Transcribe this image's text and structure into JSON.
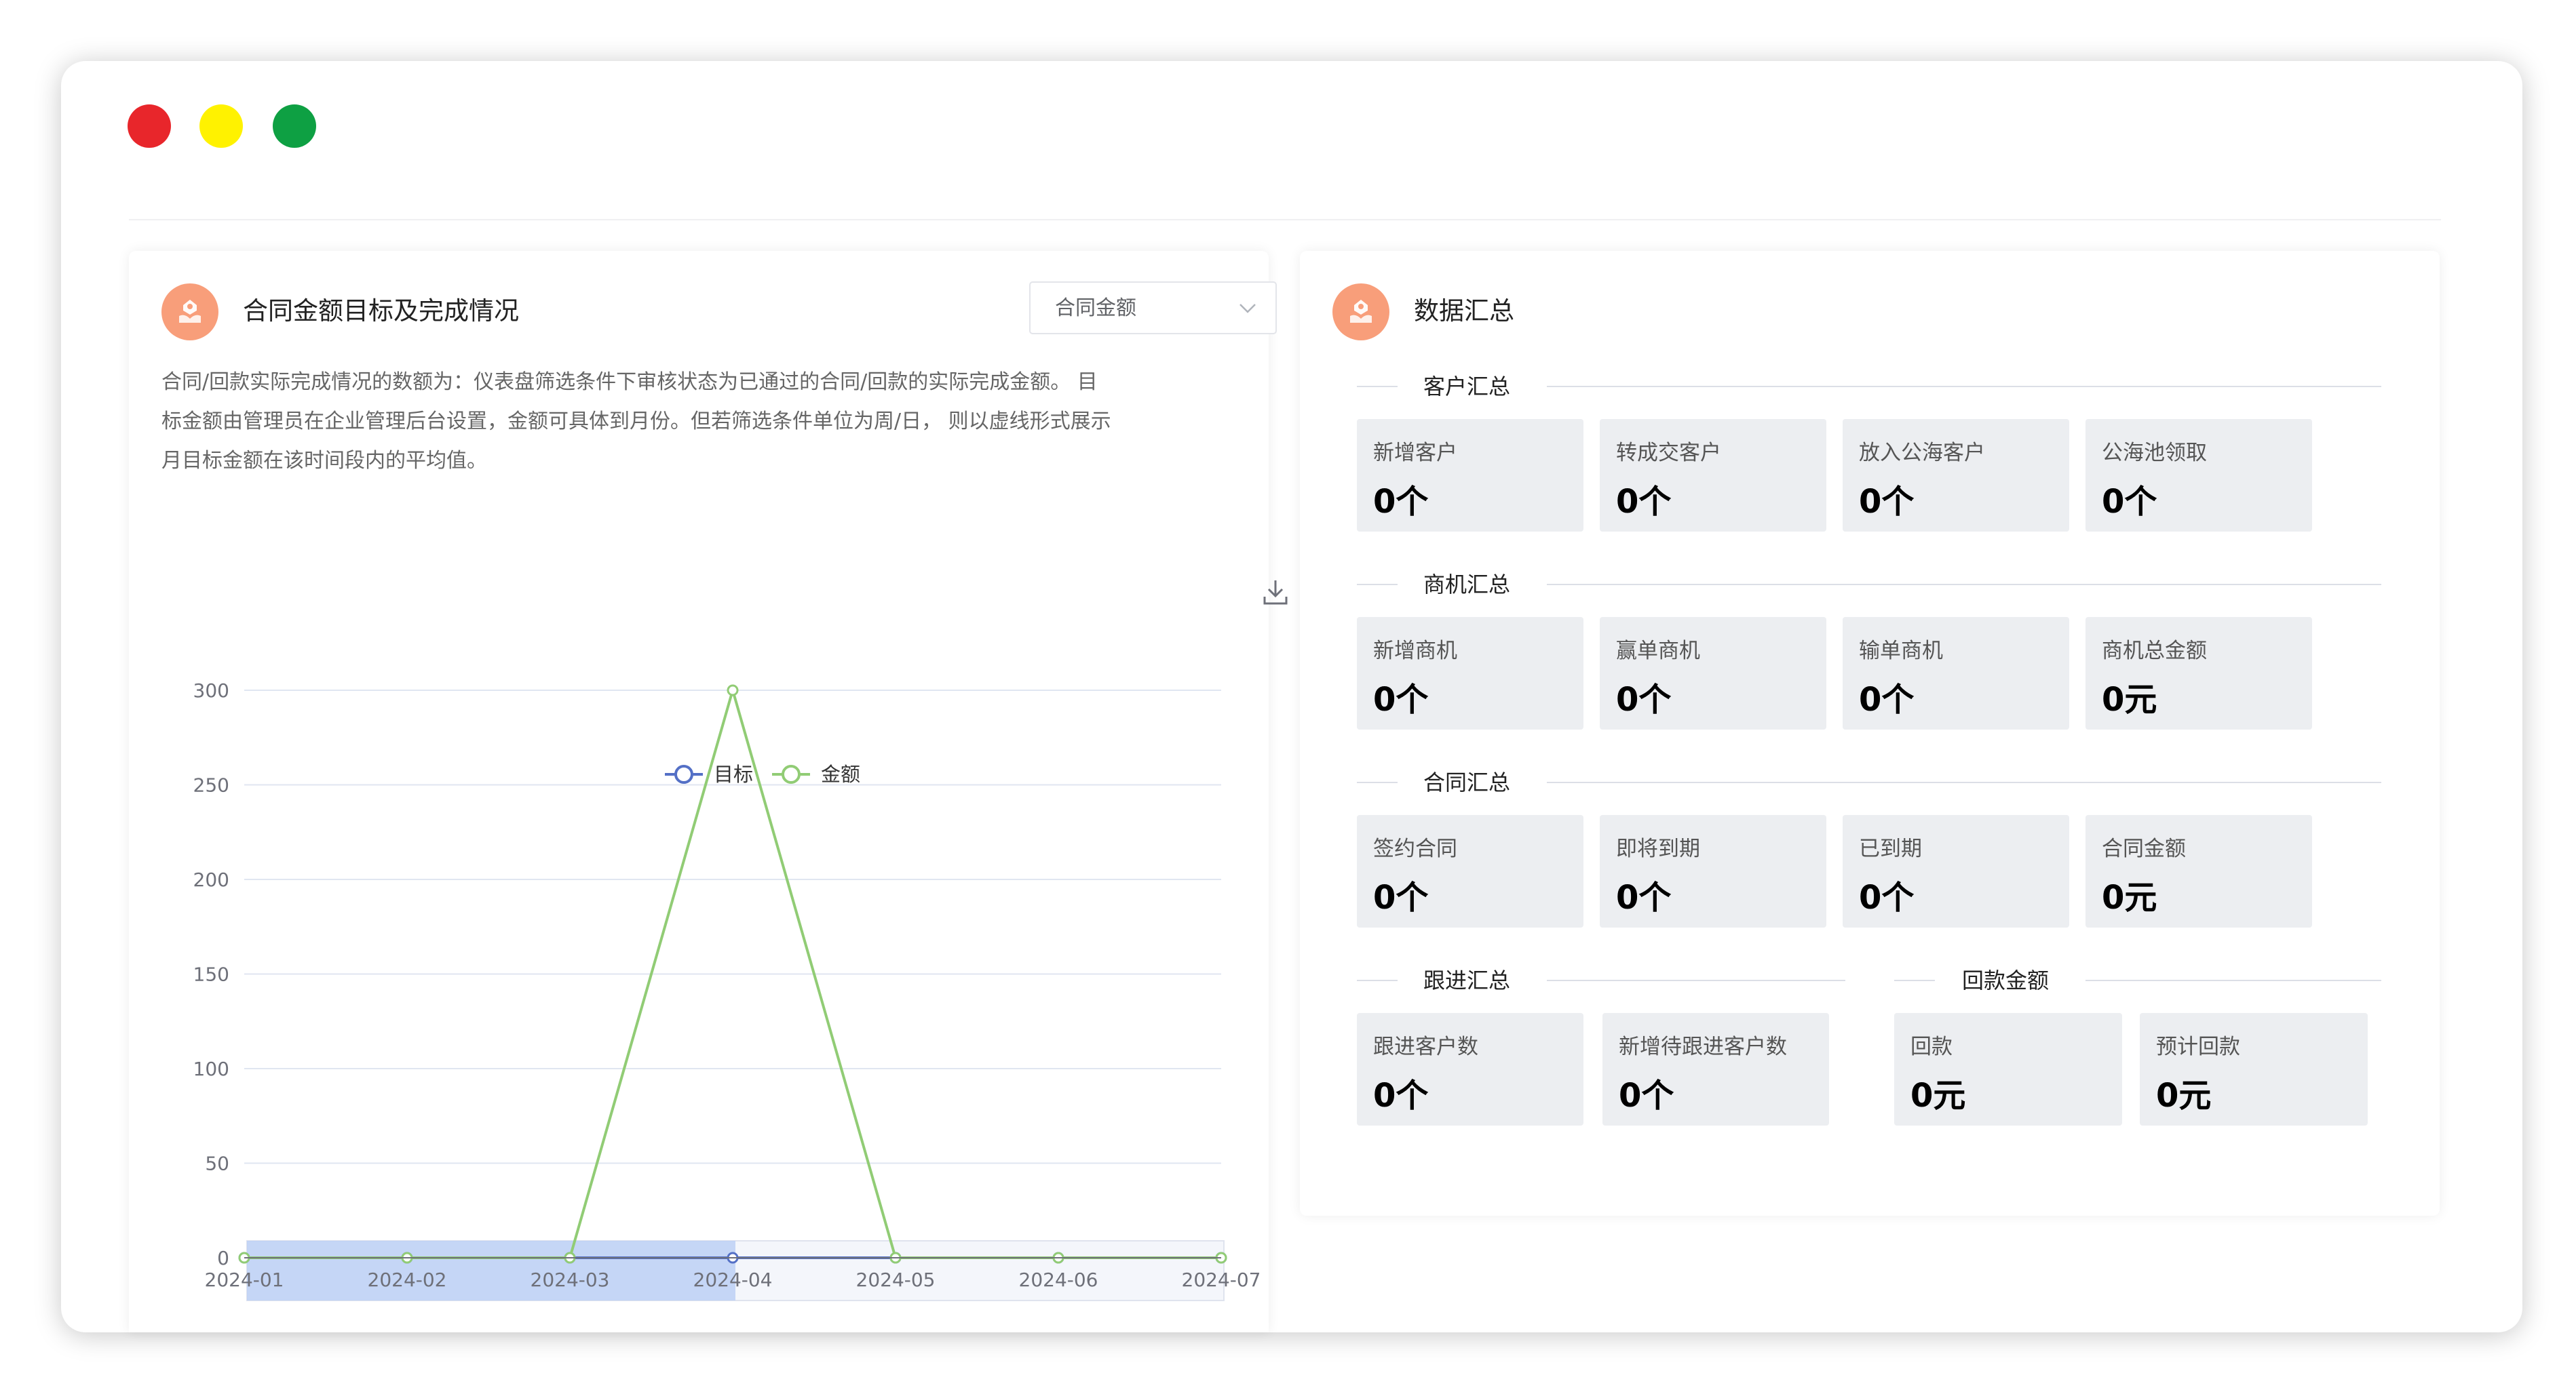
{
  "window": {
    "controls": [
      {
        "name": "close",
        "color": "#e8262b"
      },
      {
        "name": "minimize",
        "color": "#fff200"
      },
      {
        "name": "maximize",
        "color": "#0ea043"
      }
    ]
  },
  "contract_panel": {
    "title": "合同金额目标及完成情况",
    "select_value": "合同金额",
    "description_lines": [
      "合同/回款实际完成情况的数额为：仪表盘筛选条件下审核状态为已通过的合同/回款的实际完成金额。 目",
      "标金额由管理员在企业管理后台设置，金额可具体到月份。但若筛选条件单位为周/日， 则以虚线形式展示",
      "月目标金额在该时间段内的平均值。"
    ],
    "download_icon": "download-icon"
  },
  "chart_data": {
    "type": "line",
    "categories": [
      "2024-01",
      "2024-02",
      "2024-03",
      "2024-04",
      "2024-05",
      "2024-06",
      "2024-07"
    ],
    "series": [
      {
        "name": "目标",
        "color": "#5470c6",
        "values": [
          0,
          0,
          0,
          0,
          0,
          0,
          0
        ]
      },
      {
        "name": "金额",
        "color": "#91cc75",
        "values": [
          0,
          0,
          0,
          300,
          0,
          0,
          0
        ]
      }
    ],
    "yticks": [
      0,
      50,
      100,
      150,
      200,
      250,
      300
    ],
    "ylim": [
      0,
      300
    ],
    "grid": true,
    "legend": "top-center"
  },
  "summary_panel": {
    "title": "数据汇总",
    "sections": [
      {
        "title": "客户汇总",
        "cards": [
          {
            "label": "新增客户",
            "value": "0个"
          },
          {
            "label": "转成交客户",
            "value": "0个"
          },
          {
            "label": "放入公海客户",
            "value": "0个"
          },
          {
            "label": "公海池领取",
            "value": "0个"
          }
        ]
      },
      {
        "title": "商机汇总",
        "cards": [
          {
            "label": "新增商机",
            "value": "0个"
          },
          {
            "label": "赢单商机",
            "value": "0个"
          },
          {
            "label": "输单商机",
            "value": "0个"
          },
          {
            "label": "商机总金额",
            "value": "0元"
          }
        ]
      },
      {
        "title": "合同汇总",
        "cards": [
          {
            "label": "签约合同",
            "value": "0个"
          },
          {
            "label": "即将到期",
            "value": "0个"
          },
          {
            "label": "已到期",
            "value": "0个"
          },
          {
            "label": "合同金额",
            "value": "0元"
          }
        ]
      },
      {
        "title": "跟进汇总",
        "cards": [
          {
            "label": "跟进客户数",
            "value": "0个"
          },
          {
            "label": "新增待跟进客户数",
            "value": "0个"
          }
        ]
      },
      {
        "title": "回款金额",
        "cards": [
          {
            "label": "回款",
            "value": "0元"
          },
          {
            "label": "预计回款",
            "value": "0元"
          }
        ]
      }
    ]
  }
}
